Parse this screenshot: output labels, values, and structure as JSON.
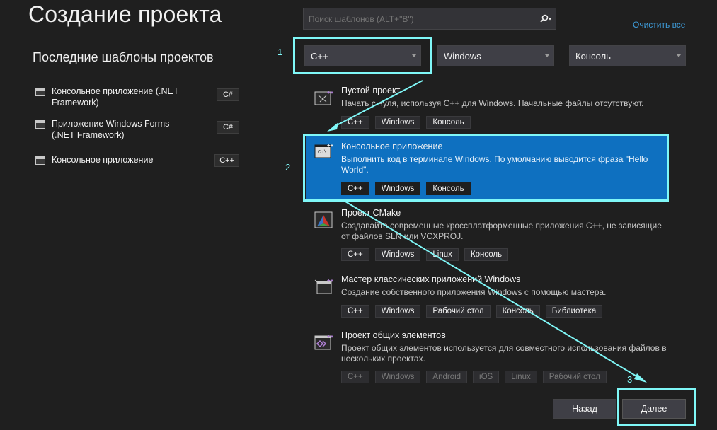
{
  "header": {
    "title": "Создание проекта"
  },
  "recent": {
    "title": "Последние шаблоны проектов",
    "items": [
      {
        "label": "Консольное приложение (.NET Framework)",
        "lang": "C#"
      },
      {
        "label": "Приложение Windows Forms (.NET Framework)",
        "lang": "C#"
      },
      {
        "label": "Консольное приложение",
        "lang": "C++"
      }
    ]
  },
  "search": {
    "placeholder": "Поиск шаблонов (ALT+\"B\")"
  },
  "filters": {
    "clear_all": "Очистить все",
    "language": "C++",
    "platform": "Windows",
    "project_type": "Консоль"
  },
  "templates": [
    {
      "name": "Пустой проект",
      "description": "Начать с нуля, используя C++ для Windows. Начальные файлы отсутствуют.",
      "tags": [
        "C++",
        "Windows",
        "Консоль"
      ]
    },
    {
      "name": "Консольное приложение",
      "description": "Выполнить код в терминале Windows. По умолчанию выводится фраза \"Hello World\".",
      "tags": [
        "C++",
        "Windows",
        "Консоль"
      ],
      "icon_text": "C:\\"
    },
    {
      "name": "Проект CMake",
      "description": "Создавайте современные кроссплатформенные приложения C++, не зависящие от файлов SLN или VCXPROJ.",
      "tags": [
        "C++",
        "Windows",
        "Linux",
        "Консоль"
      ]
    },
    {
      "name": "Мастер классических приложений Windows",
      "description": "Создание собственного приложения Windows с помощью мастера.",
      "tags": [
        "C++",
        "Windows",
        "Рабочий стол",
        "Консоль",
        "Библиотека"
      ]
    },
    {
      "name": "Проект общих элементов",
      "description": "Проект общих элементов используется для совместного использования файлов в нескольких проектах.",
      "tags": [
        "C++",
        "Windows",
        "Android",
        "iOS",
        "Linux",
        "Рабочий стол"
      ]
    }
  ],
  "buttons": {
    "back": "Назад",
    "next": "Далее"
  },
  "annotations": {
    "step1": "1",
    "step2": "2",
    "step3": "3"
  },
  "colors": {
    "highlight": "#7ff7f7",
    "selected": "#0e70c0",
    "link": "#3e9bd8",
    "background": "#1f1f1f"
  }
}
